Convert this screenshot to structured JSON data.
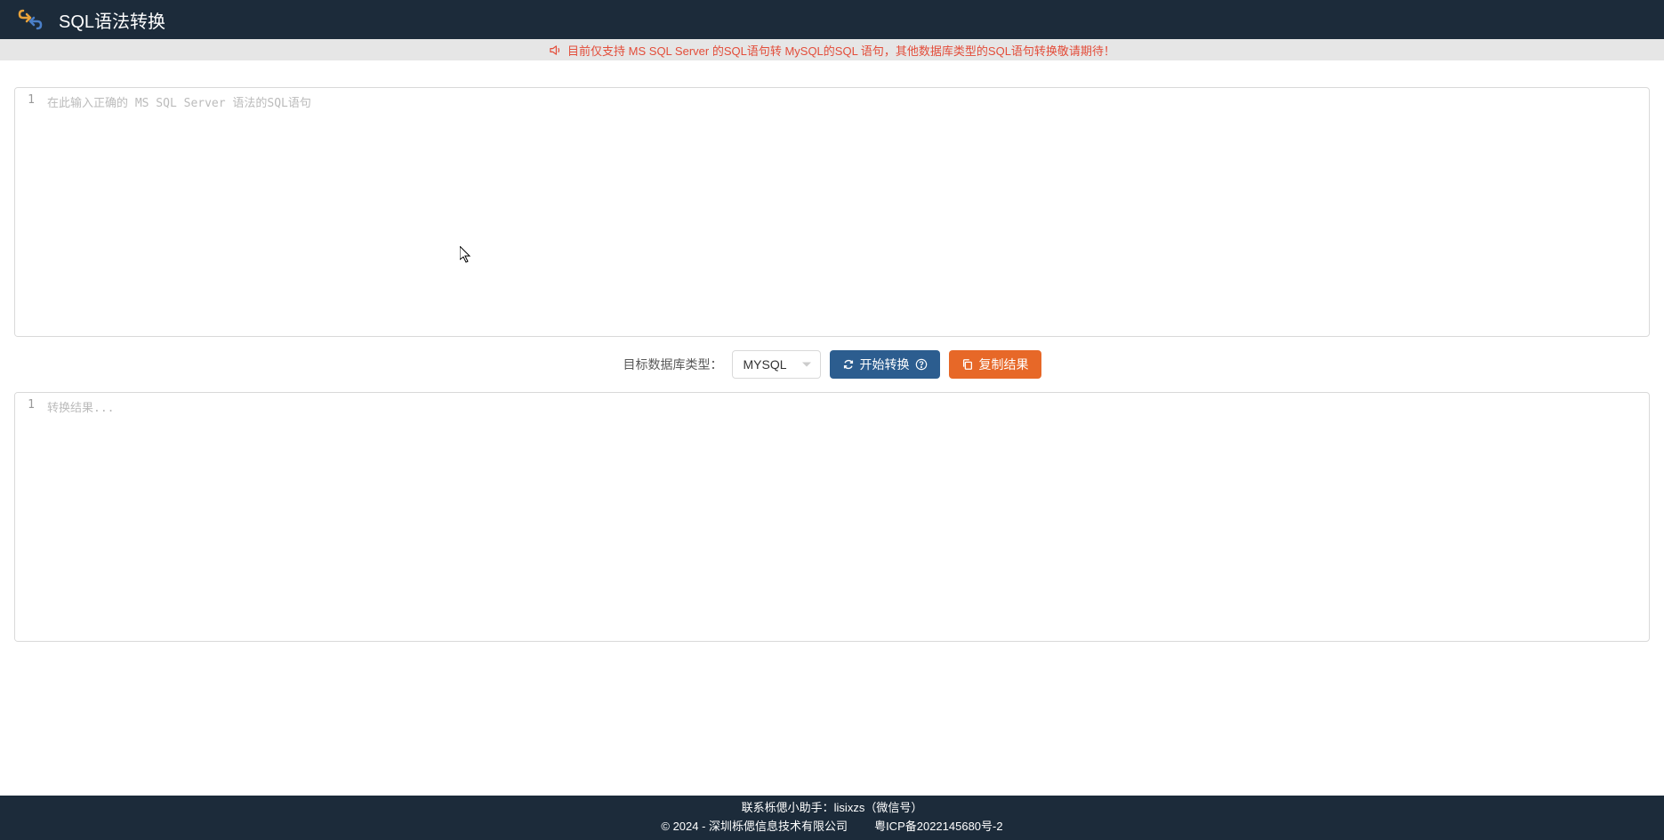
{
  "header": {
    "title": "SQL语法转换"
  },
  "notice": {
    "text": "目前仅支持 MS SQL Server 的SQL语句转 MySQL的SQL 语句，其他数据库类型的SQL语句转换敬请期待！"
  },
  "input_editor": {
    "line_number": "1",
    "placeholder": "在此输入正确的 MS SQL Server 语法的SQL语句"
  },
  "controls": {
    "target_label": "目标数据库类型：",
    "target_value": "MYSQL",
    "convert_label": "开始转换",
    "copy_label": "复制结果"
  },
  "output_editor": {
    "line_number": "1",
    "placeholder": "转换结果..."
  },
  "footer": {
    "contact": "联系栎偲小助手：lisixzs（微信号）",
    "copyright": "© 2024 - 深圳栎偲信息技术有限公司",
    "icp": "粤ICP备2022145680号-2"
  }
}
